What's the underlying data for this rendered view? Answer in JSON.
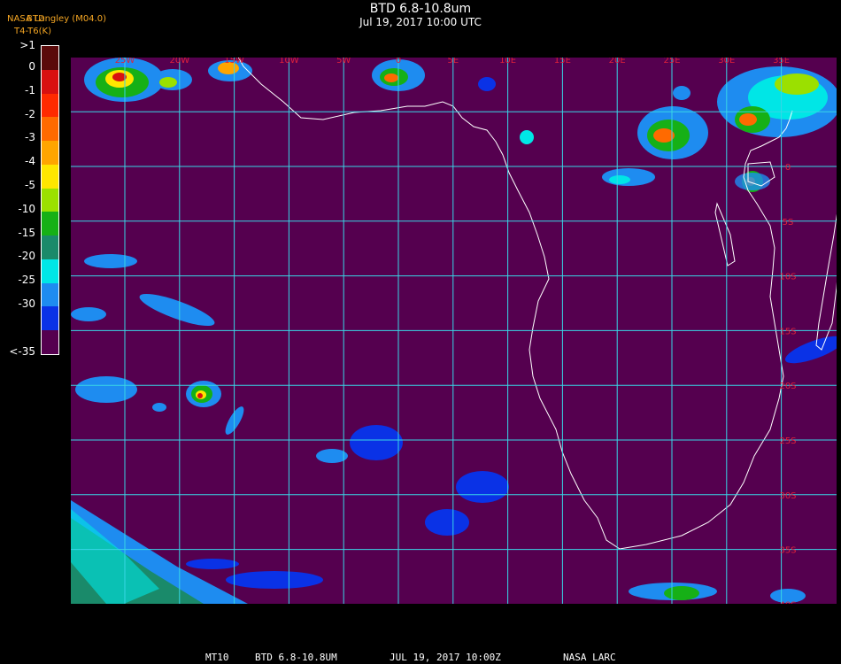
{
  "header": {
    "title": "BTD 6.8-10.8um",
    "timestamp": "Jul 19, 2017 10:00 UTC",
    "source_line1": "NASA Langley (M04.0)",
    "source_line2": "T4-T6(K)",
    "product_label": "BTD"
  },
  "colorbar": {
    "labels": [
      ">1",
      "0",
      "-1",
      "-2",
      "-3",
      "-4",
      "-5",
      "-10",
      "-15",
      "-20",
      "-25",
      "-30",
      "<-35"
    ],
    "colors": [
      "#5a0a0a",
      "#d81010",
      "#ff2a00",
      "#ff6a00",
      "#ffa500",
      "#ffe600",
      "#9be000",
      "#16b016",
      "#1a8a6a",
      "#00e6e6",
      "#1e8cf0",
      "#0a32e6",
      "#55004f"
    ]
  },
  "map": {
    "background_color": "#55004f",
    "grid_color": "#38d6e6",
    "coast_color": "#ffffff",
    "lon_labels": [
      "25W",
      "20W",
      "15W",
      "10W",
      "5W",
      "0",
      "5E",
      "10E",
      "15E",
      "20E",
      "25E",
      "30E",
      "35E"
    ],
    "lat_labels": [
      "0",
      "5S",
      "10S",
      "15S",
      "20S",
      "25S",
      "30S",
      "35S",
      "40S"
    ],
    "label_color": "#e0203a"
  },
  "footer": {
    "satellite": "MT10",
    "product": "BTD 6.8-10.8UM",
    "date_time": "JUL 19, 2017 10:00Z",
    "agency": "NASA LARC"
  }
}
